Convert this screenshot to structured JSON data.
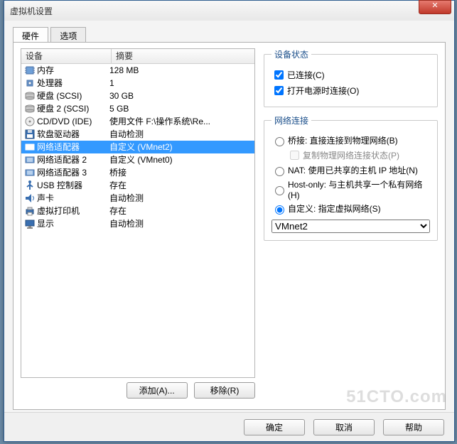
{
  "window": {
    "title": "虚拟机设置",
    "close_glyph": "✕"
  },
  "tabs": [
    {
      "label": "硬件",
      "active": true
    },
    {
      "label": "选项",
      "active": false
    }
  ],
  "listview": {
    "columns": {
      "device": "设备",
      "summary": "摘要"
    },
    "rows": [
      {
        "icon": "chip-icon",
        "name": "内存",
        "summary": "128 MB",
        "selected": false
      },
      {
        "icon": "cpu-icon",
        "name": "处理器",
        "summary": "1",
        "selected": false
      },
      {
        "icon": "hdd-icon",
        "name": "硬盘 (SCSI)",
        "summary": "30 GB",
        "selected": false
      },
      {
        "icon": "hdd-icon",
        "name": "硬盘 2 (SCSI)",
        "summary": "5 GB",
        "selected": false
      },
      {
        "icon": "cd-icon",
        "name": "CD/DVD (IDE)",
        "summary": "使用文件 F:\\操作系统\\Re...",
        "selected": false
      },
      {
        "icon": "floppy-icon",
        "name": "软盘驱动器",
        "summary": "自动检测",
        "selected": false
      },
      {
        "icon": "nic-icon",
        "name": "网络适配器",
        "summary": "自定义 (VMnet2)",
        "selected": true
      },
      {
        "icon": "nic-icon",
        "name": "网络适配器 2",
        "summary": "自定义 (VMnet0)",
        "selected": false
      },
      {
        "icon": "nic-icon",
        "name": "网络适配器 3",
        "summary": "桥接",
        "selected": false
      },
      {
        "icon": "usb-icon",
        "name": "USB 控制器",
        "summary": "存在",
        "selected": false
      },
      {
        "icon": "sound-icon",
        "name": "声卡",
        "summary": "自动检测",
        "selected": false
      },
      {
        "icon": "printer-icon",
        "name": "虚拟打印机",
        "summary": "存在",
        "selected": false
      },
      {
        "icon": "display-icon",
        "name": "显示",
        "summary": "自动检测",
        "selected": false
      }
    ]
  },
  "left_buttons": {
    "add": "添加(A)...",
    "remove": "移除(R)"
  },
  "panel": {
    "status": {
      "legend": "设备状态",
      "connected": {
        "label": "已连接(C)",
        "checked": true
      },
      "connect_pon": {
        "label": "打开电源时连接(O)",
        "checked": true
      }
    },
    "network": {
      "legend": "网络连接",
      "bridged": {
        "label": "桥接: 直接连接到物理网络(B)",
        "checked": false
      },
      "replicate": {
        "label": "复制物理网络连接状态(P)",
        "enabled": false,
        "checked": false
      },
      "nat": {
        "label": "NAT: 使用已共享的主机 IP 地址(N)",
        "checked": false
      },
      "hostonly": {
        "label": "Host-only: 与主机共享一个私有网络(H)",
        "checked": false
      },
      "custom": {
        "label": "自定义: 指定虚拟网络(S)",
        "checked": true
      },
      "vnet_value": "VMnet2"
    }
  },
  "footer": {
    "ok": "确定",
    "cancel": "取消",
    "help": "帮助"
  },
  "watermark": "51CTO.com"
}
